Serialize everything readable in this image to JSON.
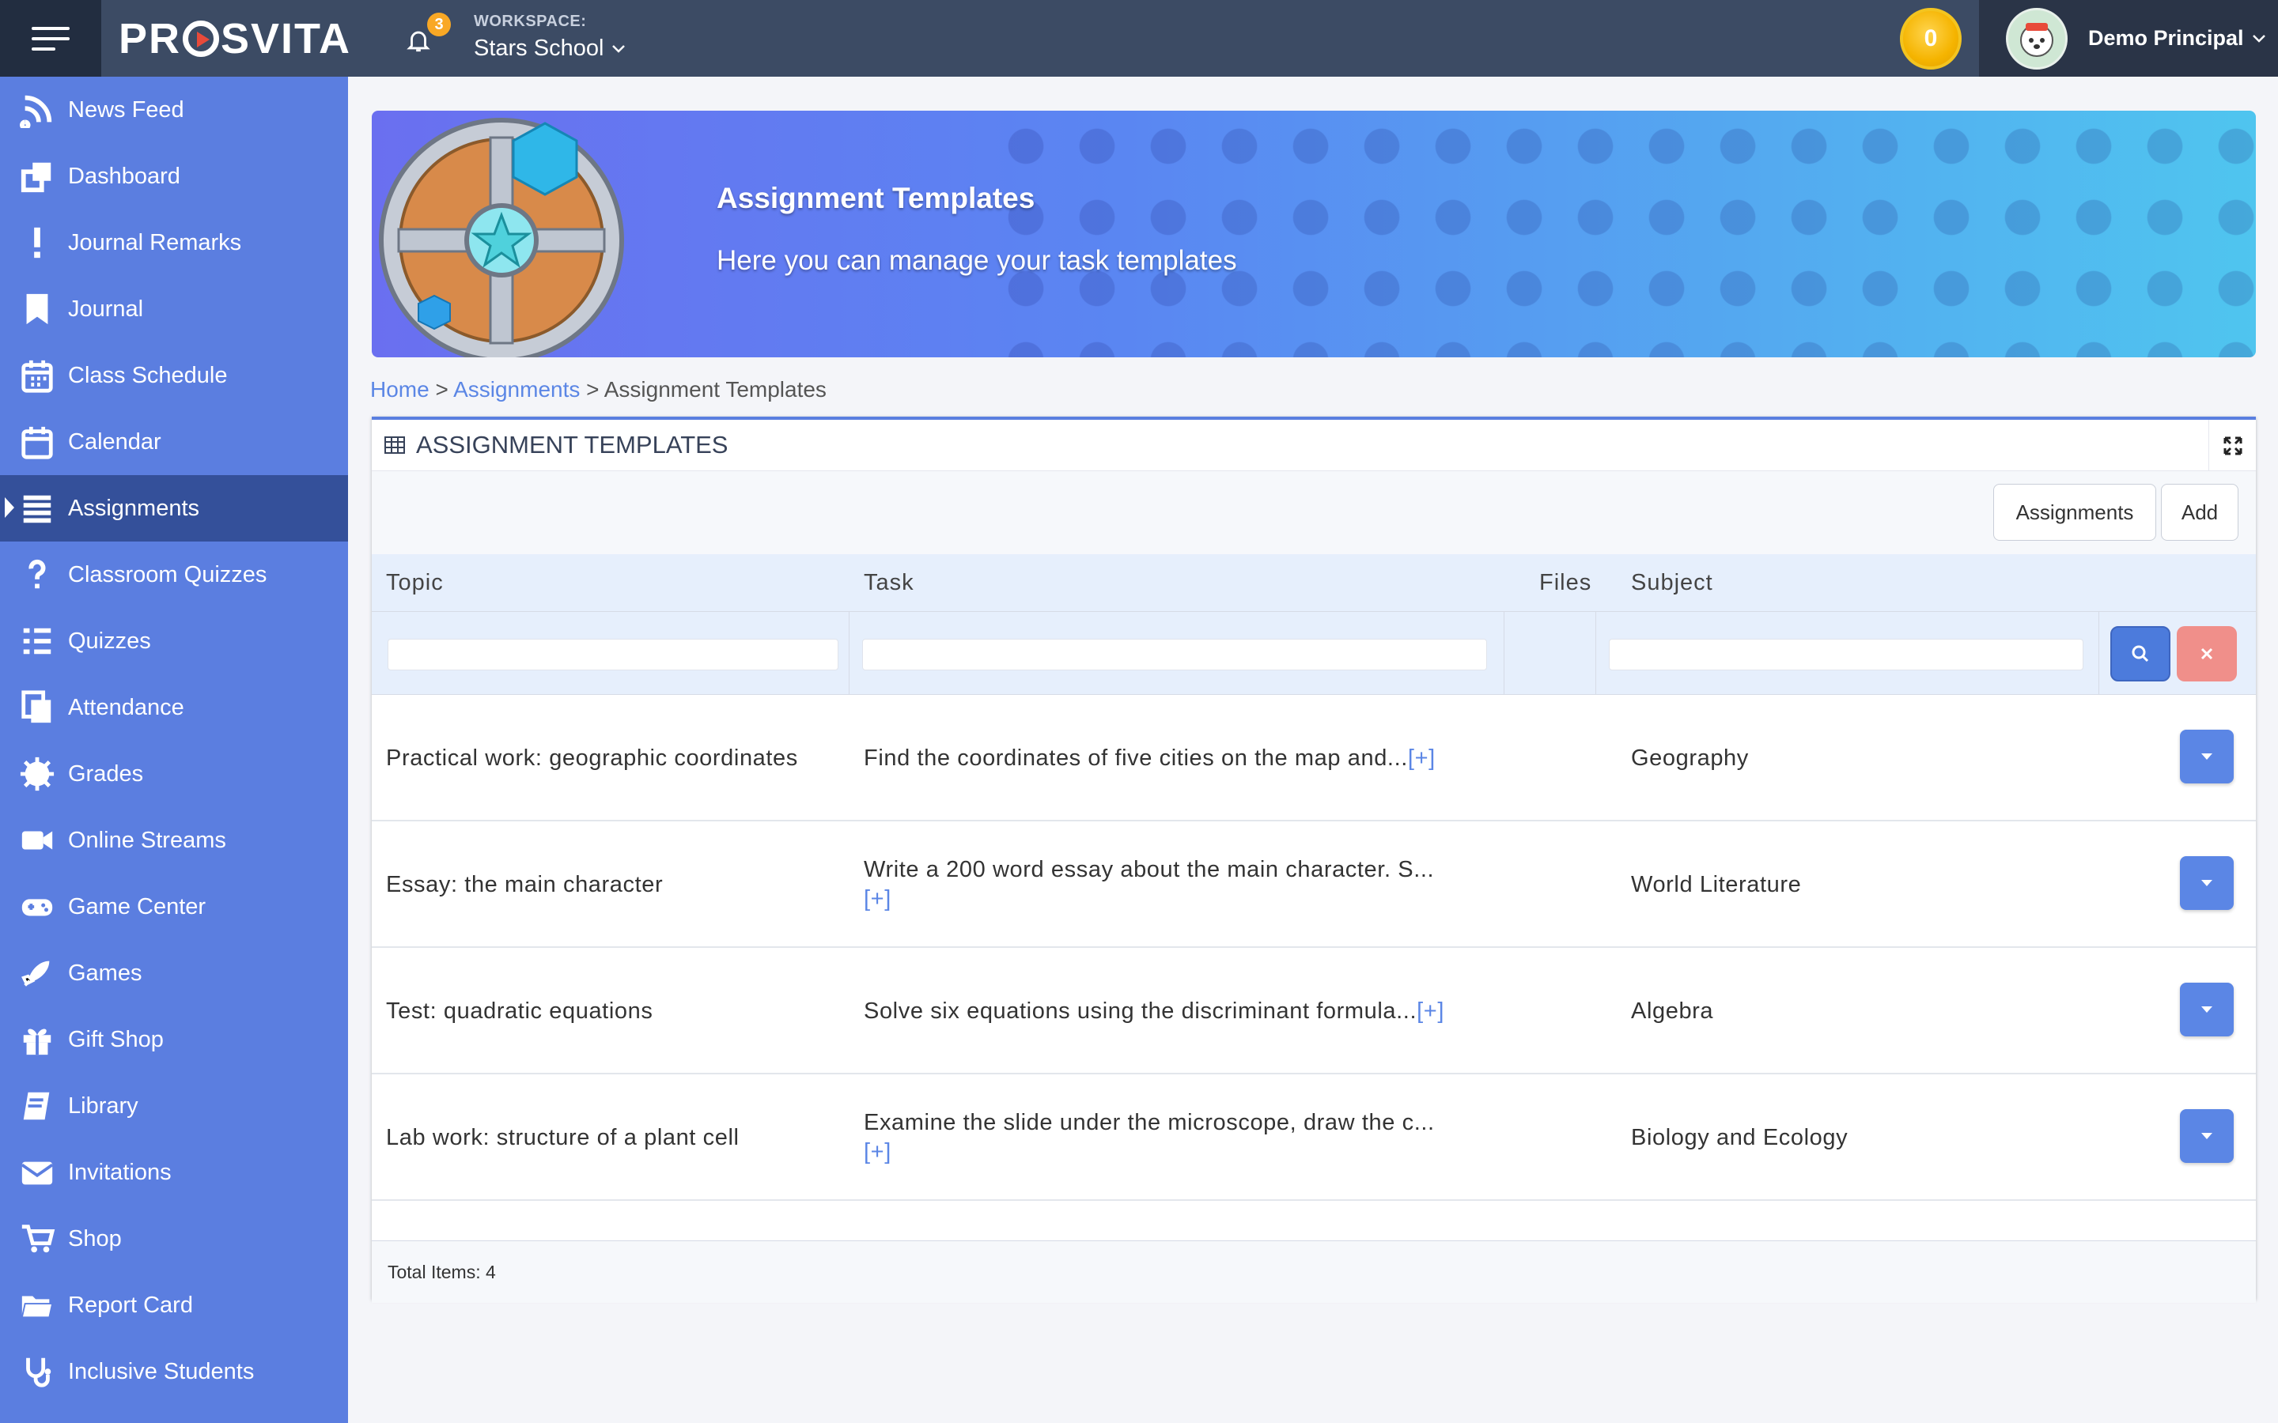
{
  "topbar": {
    "brand": "PROSVITA",
    "notifications_count": "3",
    "workspace_label": "WORKSPACE:",
    "workspace_value": "Stars School",
    "coins": "0",
    "user_name": "Demo Principal"
  },
  "sidebar": {
    "items": [
      {
        "label": "News Feed",
        "icon": "rss-icon"
      },
      {
        "label": "Dashboard",
        "icon": "dashboard-icon"
      },
      {
        "label": "Journal Remarks",
        "icon": "exclamation-icon"
      },
      {
        "label": "Journal",
        "icon": "bookmark-icon"
      },
      {
        "label": "Class Schedule",
        "icon": "calendar-grid-icon"
      },
      {
        "label": "Calendar",
        "icon": "calendar-icon"
      },
      {
        "label": "Assignments",
        "icon": "list-icon",
        "active": true
      },
      {
        "label": "Classroom Quizzes",
        "icon": "question-icon"
      },
      {
        "label": "Quizzes",
        "icon": "checklist-icon"
      },
      {
        "label": "Attendance",
        "icon": "copy-icon"
      },
      {
        "label": "Grades",
        "icon": "badge-icon"
      },
      {
        "label": "Online Streams",
        "icon": "video-icon"
      },
      {
        "label": "Game Center",
        "icon": "gamepad-icon"
      },
      {
        "label": "Games",
        "icon": "rocket-icon"
      },
      {
        "label": "Gift Shop",
        "icon": "gift-icon"
      },
      {
        "label": "Library",
        "icon": "book-icon"
      },
      {
        "label": "Invitations",
        "icon": "envelope-icon"
      },
      {
        "label": "Shop",
        "icon": "cart-icon"
      },
      {
        "label": "Report Card",
        "icon": "folder-icon"
      },
      {
        "label": "Inclusive Students",
        "icon": "stethoscope-icon"
      }
    ]
  },
  "banner": {
    "title": "Assignment Templates",
    "subtitle": "Here you can manage your task templates"
  },
  "breadcrumb": {
    "home": "Home",
    "sep": ">",
    "assignments": "Assignments",
    "current": "Assignment Templates"
  },
  "panel": {
    "title": "ASSIGNMENT TEMPLATES",
    "assignments_button": "Assignments",
    "add_button": "Add",
    "columns": [
      "Topic",
      "Task",
      "Files",
      "Subject"
    ],
    "rows": [
      {
        "topic": "Practical work: geographic coordinates",
        "task": "Find the coordinates of five cities on the map and...",
        "more": "[+]",
        "subject": "Geography"
      },
      {
        "topic": "Essay: the main character",
        "task": "Write a 200 word essay about the main character. S...",
        "more": "[+]",
        "subject": "World Literature"
      },
      {
        "topic": "Test: quadratic equations",
        "task": "Solve six equations using the discriminant formula...",
        "more": "[+]",
        "subject": "Algebra"
      },
      {
        "topic": "Lab work: structure of a plant cell",
        "task": "Examine the slide under the microscope, draw the c...",
        "more": "[+]",
        "subject": "Biology and Ecology"
      }
    ],
    "total_items": "Total Items: 4"
  },
  "colors": {
    "topbar": "#3c4b64",
    "sidebar": "#5b7ee0",
    "sidebar_active": "#34509a",
    "accent": "#5b86e5",
    "clear_button": "#f08f8a",
    "coin": "#f5b400"
  }
}
